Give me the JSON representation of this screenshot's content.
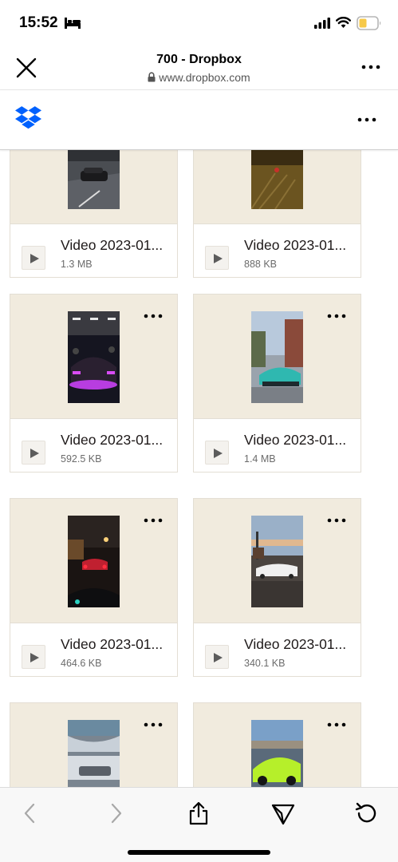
{
  "status": {
    "time": "15:52"
  },
  "browser": {
    "title": "700 - Dropbox",
    "url": "www.dropbox.com"
  },
  "files": [
    {
      "name": "Video 2023-01...",
      "size": "1.3 MB",
      "thumb": "car-garage"
    },
    {
      "name": "Video 2023-01...",
      "size": "888 KB",
      "thumb": "night-road"
    },
    {
      "name": "Video 2023-01...",
      "size": "592.5 KB",
      "thumb": "car-show-purple"
    },
    {
      "name": "Video 2023-01...",
      "size": "1.4 MB",
      "thumb": "teal-lamborghini"
    },
    {
      "name": "Video 2023-01...",
      "size": "464.6 KB",
      "thumb": "night-traffic"
    },
    {
      "name": "Video 2023-01...",
      "size": "340.1 KB",
      "thumb": "white-car-pier"
    },
    {
      "name": "",
      "size": "",
      "thumb": "tunnel-car"
    },
    {
      "name": "",
      "size": "",
      "thumb": "lime-porsche"
    }
  ],
  "colors": {
    "dropbox_blue": "#0061fe",
    "card_thumb_bg": "#f1ebde",
    "battery_yellow": "#f7c948"
  },
  "icons": {
    "close": "close-icon",
    "lock": "lock-icon",
    "more": "more-horizontal-icon",
    "play": "play-icon",
    "back": "chevron-left-icon",
    "forward": "chevron-right-icon",
    "share": "share-icon",
    "send": "send-icon",
    "reload": "reload-icon"
  }
}
